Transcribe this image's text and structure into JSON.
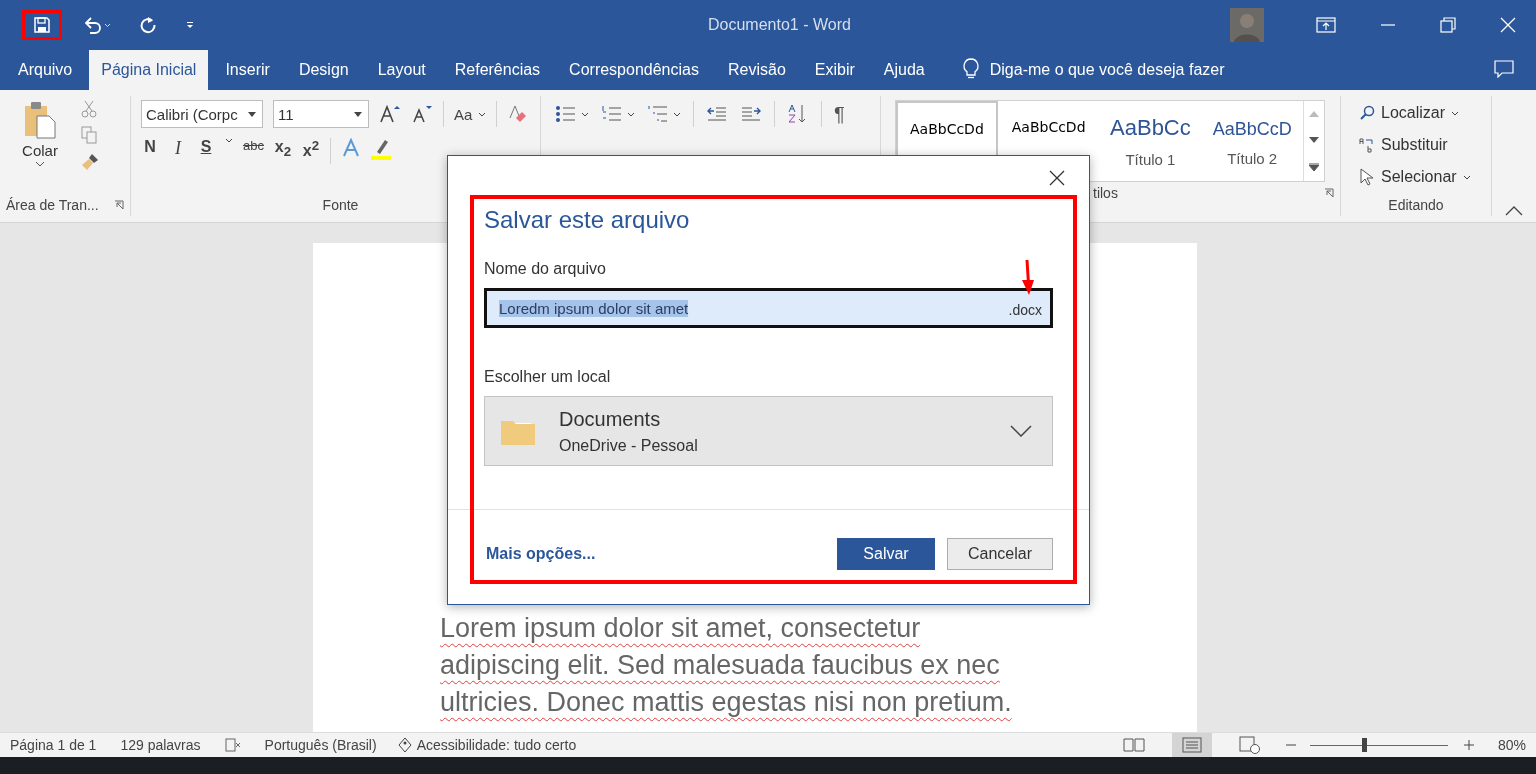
{
  "title_bar": {
    "quick_access": [
      {
        "kind": "save",
        "highlighted": true
      },
      {
        "kind": "undo"
      },
      {
        "kind": "redo"
      },
      {
        "kind": "customize"
      }
    ],
    "title": "Documento1  -  Word"
  },
  "tabs": [
    {
      "label": "Arquivo",
      "selected": false
    },
    {
      "label": "Página Inicial",
      "selected": true
    },
    {
      "label": "Inserir",
      "selected": false
    },
    {
      "label": "Design",
      "selected": false
    },
    {
      "label": "Layout",
      "selected": false
    },
    {
      "label": "Referências",
      "selected": false
    },
    {
      "label": "Correspondências",
      "selected": false
    },
    {
      "label": "Revisão",
      "selected": false
    },
    {
      "label": "Exibir",
      "selected": false
    },
    {
      "label": "Ajuda",
      "selected": false
    }
  ],
  "tell_me": "Diga-me o que você deseja fazer",
  "ribbon": {
    "clipboard": {
      "paste": "Colar",
      "label": "Área de Tran..."
    },
    "font": {
      "font_name": "Calibri (Corpc",
      "font_size": "11",
      "label": "Fonte",
      "case_button": "Aa",
      "formats": [
        {
          "text": "N",
          "kind": "bold"
        },
        {
          "text": "I",
          "kind": "italic"
        },
        {
          "text": "S",
          "kind": "underline"
        },
        {
          "text": "abc",
          "kind": "strike"
        },
        {
          "text": "x$_{2}$",
          "kind": "script"
        },
        {
          "text": "x$^{2}$",
          "kind": "script"
        }
      ]
    },
    "paragraph": {
      "pilcrow": "¶"
    },
    "styles": {
      "label": "tilos",
      "items": [
        {
          "sample": "AaBbCcDd",
          "kind": "normal",
          "selected": true
        },
        {
          "sample": "AaBbCcDd",
          "kind": "normal",
          "selected": false
        },
        {
          "sample": "AaBbCc",
          "name": "Título 1",
          "kind": "heading1",
          "selected": false
        },
        {
          "sample": "AaBbCcD",
          "name": "Título 2",
          "kind": "heading2",
          "selected": false
        }
      ]
    },
    "editing": {
      "label": "Editando",
      "items": [
        {
          "label": "Localizar",
          "kind": "find",
          "dropdown": true
        },
        {
          "label": "Substituir",
          "kind": "replace",
          "dropdown": false
        },
        {
          "label": "Selecionar",
          "kind": "select",
          "dropdown": true
        }
      ]
    }
  },
  "document": {
    "lines": [
      "Lorem ipsum dolor sit amet, consectetur",
      "adipiscing elit. Sed malesuada faucibus ex nec",
      "ultricies. Donec mattis egestas nisi non pretium."
    ]
  },
  "dialog": {
    "highlighted": true,
    "title": "Salvar este arquivo",
    "filename_label": "Nome do arquivo",
    "filename": "Loredm ipsum dolor sit amet",
    "extension": ".docx",
    "arrow": true,
    "location_label": "Escolher um local",
    "location": {
      "name": "Documents",
      "detail": "OneDrive - Pessoal"
    },
    "more_options": "Mais opções...",
    "buttons": [
      {
        "label": "Salvar",
        "kind": "primary"
      },
      {
        "label": "Cancelar",
        "kind": "secondary"
      }
    ]
  },
  "status_bar": {
    "page": "Página 1 de 1",
    "words": "129 palavras",
    "language": "Português (Brasil)",
    "accessibility": "Acessibilidade: tudo certo",
    "views": [
      {
        "kind": "read",
        "selected": false
      },
      {
        "kind": "print",
        "selected": true
      },
      {
        "kind": "web",
        "selected": false
      }
    ],
    "zoom": {
      "level": 0.39,
      "reading": "80%"
    }
  }
}
